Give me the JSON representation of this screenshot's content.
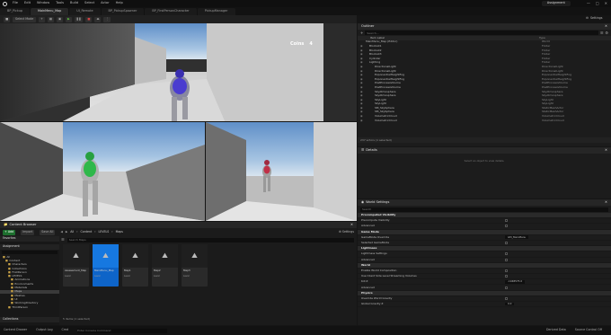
{
  "titlebar": {
    "menu": [
      "File",
      "Edit",
      "Window",
      "Tools",
      "Build",
      "Select",
      "Actor",
      "Help"
    ],
    "project": "Assignment",
    "window_controls": [
      "minimize-icon",
      "maximize-icon",
      "close-icon"
    ]
  },
  "tabs": [
    "BP_Pickup",
    "MainMenu_Map",
    "UI_Remote",
    "BP_PickupSpawner",
    "BP_FirstPersonCharacter",
    "PickupManager"
  ],
  "active_tab": "MainMenu_Map",
  "toolbar": {
    "mode": "Select Mode",
    "settings": "Settings"
  },
  "viewport": {
    "coins_label": "Coins",
    "coins_value": "4"
  },
  "outliner": {
    "title": "Outliner",
    "search_placeholder": "Search...",
    "col_label": "Item Label",
    "col_type": "Type",
    "rows": [
      {
        "label": "MainMenu_Map (Editor)",
        "type": "World"
      },
      {
        "label": "Blocks01",
        "type": "Folder"
      },
      {
        "label": "Blocks02",
        "type": "Folder"
      },
      {
        "label": "Blocks03",
        "type": "Folder"
      },
      {
        "label": "Cylinder",
        "type": "Folder"
      },
      {
        "label": "Lighting",
        "type": "Folder"
      },
      {
        "label": "DirectionalLight",
        "type": "DirectionalLight"
      },
      {
        "label": "DirectionalLight",
        "type": "DirectionalLight"
      },
      {
        "label": "ExponentialHeightFog",
        "type": "ExponentialHeightFog"
      },
      {
        "label": "ExponentialHeightFog",
        "type": "ExponentialHeightFog"
      },
      {
        "label": "PostProcessVolume",
        "type": "PostProcessVolume"
      },
      {
        "label": "PostProcessVolume",
        "type": "PostProcessVolume"
      },
      {
        "label": "SkyAtmosphere",
        "type": "SkyAtmosphere"
      },
      {
        "label": "SkyAtmosphere",
        "type": "SkyAtmosphere"
      },
      {
        "label": "SkyLight",
        "type": "SkyLight"
      },
      {
        "label": "SkyLight",
        "type": "SkyLight"
      },
      {
        "label": "SM_SkySphere",
        "type": "StaticMeshActor"
      },
      {
        "label": "SM_SkySphere",
        "type": "StaticMeshActor"
      },
      {
        "label": "VolumetricCloud",
        "type": "VolumetricCloud"
      },
      {
        "label": "VolumetricCloud",
        "type": "VolumetricCloud"
      }
    ],
    "footer": "237 actors (1 selected)"
  },
  "details": {
    "title": "Details",
    "empty": "Select an object to view details."
  },
  "world_settings": {
    "title": "World Settings",
    "search_placeholder": "Search",
    "rows": [
      {
        "label": "Precomputed Visibility",
        "section": true
      },
      {
        "label": "Precompute Visibility",
        "value": ""
      },
      {
        "label": "Advanced",
        "value": ""
      },
      {
        "label": "Game Mode",
        "section": true
      },
      {
        "label": "GameMode Override",
        "value": "GM_MainMenu"
      },
      {
        "label": "Selected GameMode",
        "value": ""
      },
      {
        "label": "Lightmass",
        "section": true
      },
      {
        "label": "Lightmass Settings",
        "value": ""
      },
      {
        "label": "Advanced",
        "value": ""
      },
      {
        "label": "World",
        "section": true
      },
      {
        "label": "Enable World Composition",
        "value": ""
      },
      {
        "label": "Use Client Side Level Streaming Volumes",
        "value": ""
      },
      {
        "label": "Kill Z",
        "value": "-1048575.0"
      },
      {
        "label": "Advanced",
        "value": ""
      },
      {
        "label": "Physics",
        "section": true
      },
      {
        "label": "Override World Gravity",
        "value": ""
      },
      {
        "label": "Global Gravity Z",
        "value": "0.0"
      }
    ]
  },
  "content_browser": {
    "title": "Content Browser",
    "add": "Add",
    "import": "Import",
    "save_all": "Save All",
    "path": [
      "All",
      "Content",
      "LEVELS",
      "Maps"
    ],
    "settings": "Settings",
    "search_placeholder": "Search Maps",
    "favorites": "Favorites",
    "project": "Assignment",
    "tree": [
      "All",
      "Content",
      "Characters",
      "Collections",
      "FirstPerson",
      "LEVELS",
      "Animations",
      "Environments",
      "Materials",
      "Maps",
      "Meshes",
      "UI",
      "WorkingDirectory",
      "ThirdPerson"
    ],
    "assets": [
      {
        "name": "Assessment_Map",
        "type": "Level"
      },
      {
        "name": "MainMenu_Map",
        "type": "Level"
      },
      {
        "name": "Map1",
        "type": "Level"
      },
      {
        "name": "Map2",
        "type": "Level"
      },
      {
        "name": "Map3",
        "type": "Level"
      }
    ],
    "selected_asset": "MainMenu_Map",
    "count": "5 items (1 selected)",
    "collections": "Collections"
  },
  "statusbar": {
    "left": [
      "Content Drawer",
      "Output Log",
      "Cmd"
    ],
    "cmd_placeholder": "Enter Console Command",
    "right": [
      "Derived Data",
      "Source Control Off"
    ]
  },
  "colors": {
    "selection": "#0e64c8",
    "accent": "#1678e0",
    "panel": "#1c1c1c",
    "header": "#262626"
  }
}
